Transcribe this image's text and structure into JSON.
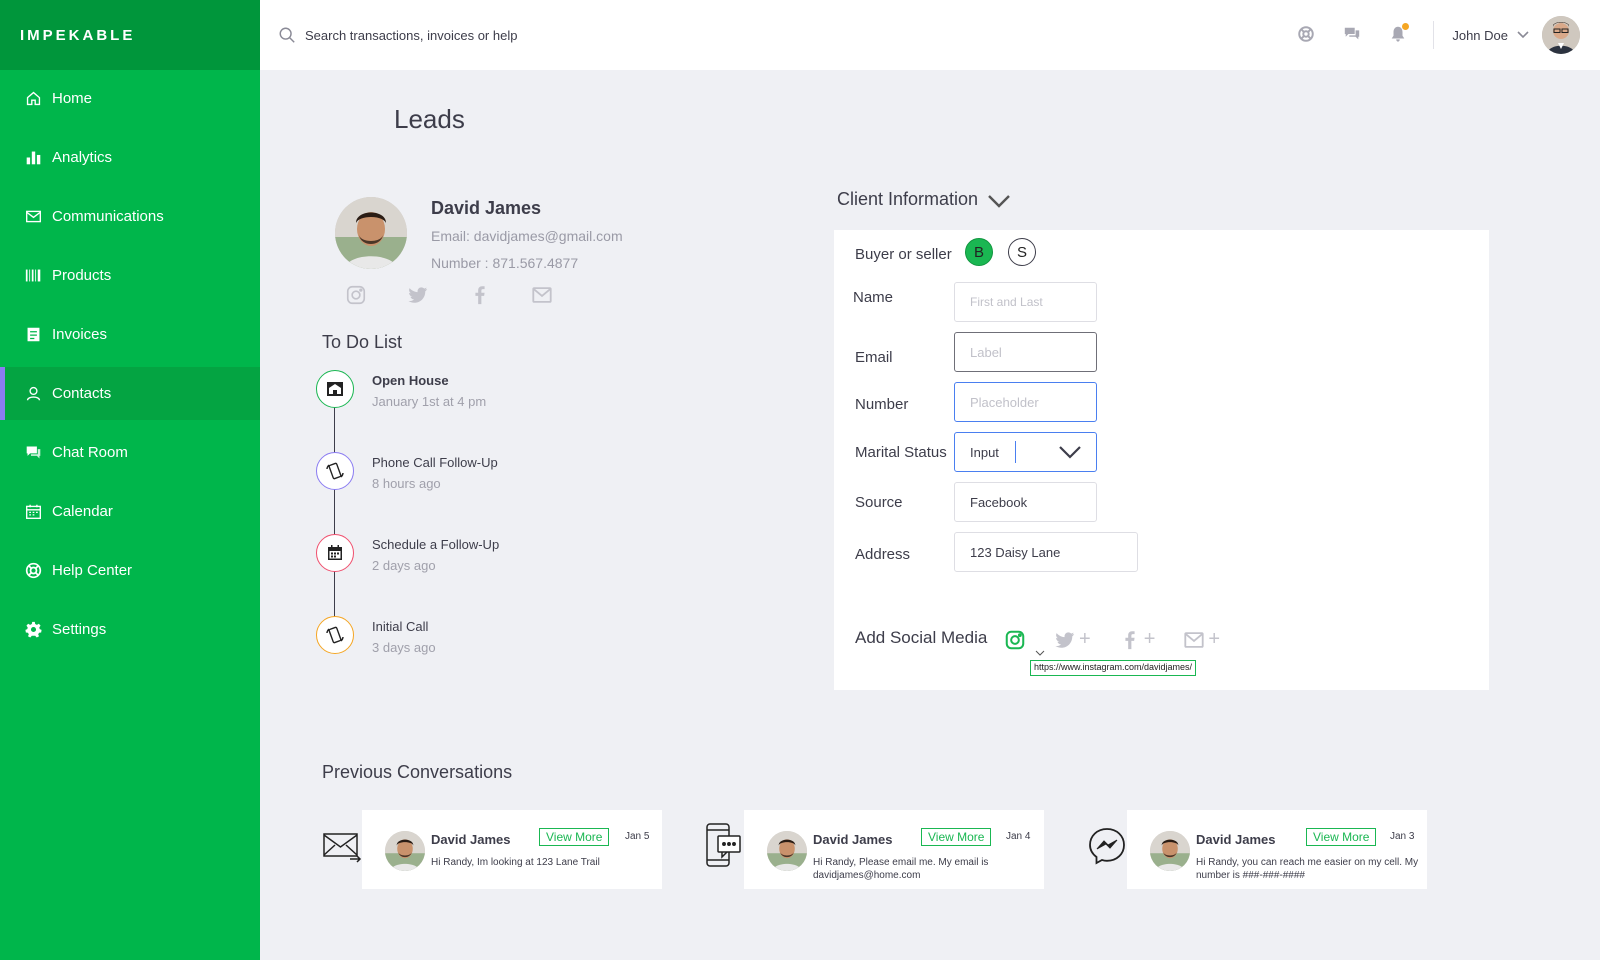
{
  "app": {
    "brand": "IMPEKABLE"
  },
  "sidebar": {
    "items": [
      {
        "label": "Home",
        "icon": "home-icon"
      },
      {
        "label": "Analytics",
        "icon": "analytics-icon"
      },
      {
        "label": "Communications",
        "icon": "mail-icon"
      },
      {
        "label": "Products",
        "icon": "barcode-icon"
      },
      {
        "label": "Invoices",
        "icon": "invoice-icon"
      },
      {
        "label": "Contacts",
        "icon": "user-icon",
        "active": true
      },
      {
        "label": "Chat Room",
        "icon": "chat-icon"
      },
      {
        "label": "Calendar",
        "icon": "calendar-icon"
      },
      {
        "label": "Help Center",
        "icon": "lifebuoy-icon"
      },
      {
        "label": "Settings",
        "icon": "gear-icon"
      }
    ]
  },
  "topbar": {
    "search_placeholder": "Search transactions, invoices or help",
    "user_name": "John Doe"
  },
  "page": {
    "title": "Leads"
  },
  "profile": {
    "name": "David James",
    "email": "Email: davidjames@gmail.com",
    "number": "Number : 871.567.4877"
  },
  "todo": {
    "title": "To Do List",
    "items": [
      {
        "label": "Open House",
        "sub": "January 1st at 4 pm",
        "icon": "house-icon",
        "color": "#1ab752"
      },
      {
        "label": "Phone Call Follow-Up",
        "sub": "8 hours ago",
        "icon": "phone-icon",
        "color": "#8b7cf2"
      },
      {
        "label": "Schedule a Follow-Up",
        "sub": "2 days ago",
        "icon": "calendar-icon",
        "color": "#f0506e"
      },
      {
        "label": "Initial Call",
        "sub": "3 days ago",
        "icon": "phone-icon",
        "color": "#f5a623"
      }
    ]
  },
  "client_info": {
    "title": "Client Information",
    "buyer_seller_label": "Buyer or seller",
    "buyer_btn": "B",
    "seller_btn": "S",
    "name_label": "Name",
    "name_placeholder": "First and Last",
    "email_label": "Email",
    "email_placeholder": "Label",
    "number_label": "Number",
    "number_placeholder": "Placeholder",
    "marital_label": "Marital Status",
    "marital_value": "Input",
    "source_label": "Source",
    "source_value": "Facebook",
    "address_label": "Address",
    "address_value": "123 Daisy Lane",
    "social_label": "Add Social Media",
    "instagram_url": "https://www.instagram.com/davidjames/"
  },
  "conversations": {
    "title": "Previous Conversations",
    "view_more": "View More",
    "items": [
      {
        "channel": "email-icon",
        "name": "David James",
        "date": "Jan 5",
        "message": "Hi Randy, Im looking at 123 Lane Trail"
      },
      {
        "channel": "sms-icon",
        "name": "David James",
        "date": "Jan 4",
        "message": "Hi Randy, Please email me. My email is davidjames@home.com"
      },
      {
        "channel": "messenger-icon",
        "name": "David James",
        "date": "Jan 3",
        "message": "Hi Randy, you can reach me easier on my cell. My number is  ###-###-####"
      }
    ]
  },
  "colors": {
    "sidebar": "#00b64b",
    "brand_bar": "#00963b",
    "accent": "#1ab752",
    "active_marker": "#8b7cf2",
    "notification": "#f5a623"
  }
}
